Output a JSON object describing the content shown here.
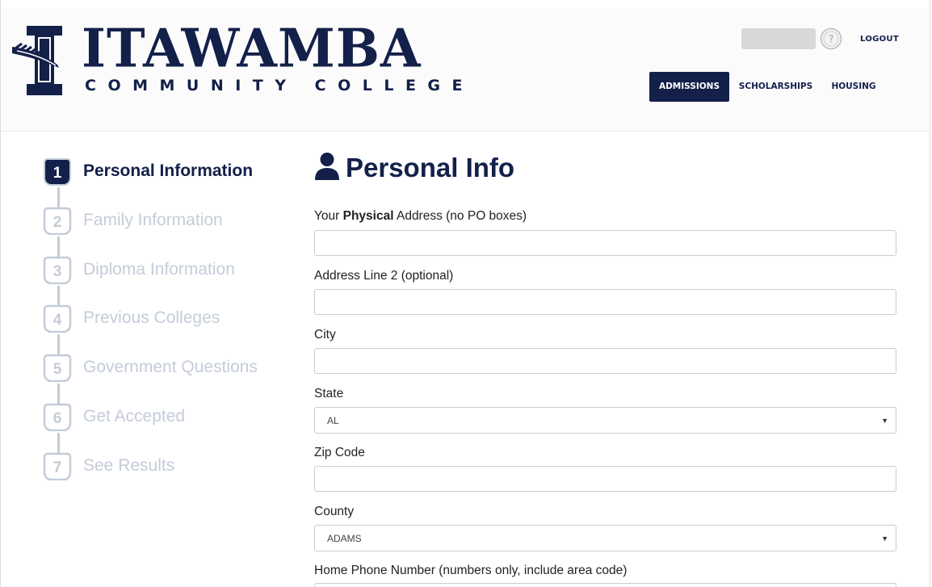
{
  "brand": {
    "name": "ITAWAMBA",
    "subtitle": "COMMUNITY COLLEGE",
    "primary_color": "#13204a",
    "muted_color": "#c4ccd8"
  },
  "header": {
    "logout_label": "LOGOUT",
    "nav": [
      {
        "label": "ADMISSIONS",
        "active": true
      },
      {
        "label": "SCHOLARSHIPS",
        "active": false
      },
      {
        "label": "HOUSING",
        "active": false
      }
    ]
  },
  "steps": [
    {
      "number": "1",
      "label": "Personal Information",
      "active": true
    },
    {
      "number": "2",
      "label": "Family Information",
      "active": false
    },
    {
      "number": "3",
      "label": "Diploma Information",
      "active": false
    },
    {
      "number": "4",
      "label": "Previous Colleges",
      "active": false
    },
    {
      "number": "5",
      "label": "Government Questions",
      "active": false
    },
    {
      "number": "6",
      "label": "Get Accepted",
      "active": false
    },
    {
      "number": "7",
      "label": "See Results",
      "active": false
    }
  ],
  "form": {
    "title": "Personal Info",
    "title_icon": "person-icon",
    "address_label_prefix": "Your ",
    "address_label_bold": "Physical",
    "address_label_suffix": " Address (no PO boxes)",
    "address_value": "",
    "address2_label": "Address Line 2 (optional)",
    "address2_value": "",
    "city_label": "City",
    "city_value": "",
    "state_label": "State",
    "state_value": "AL",
    "zip_label": "Zip Code",
    "zip_value": "",
    "county_label": "County",
    "county_value": "ADAMS",
    "phone_label": "Home Phone Number (numbers only, include area code)"
  }
}
